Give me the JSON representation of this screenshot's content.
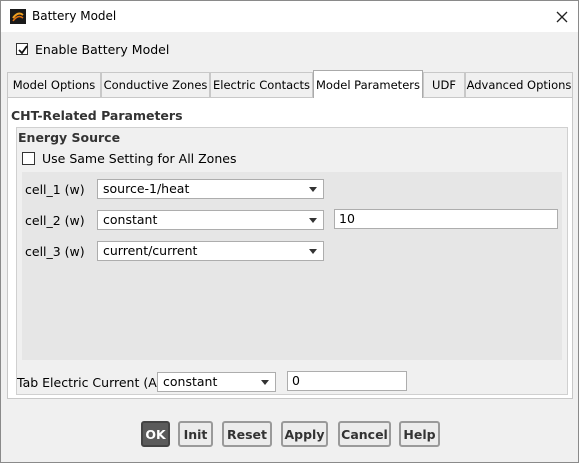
{
  "window": {
    "title": "Battery Model"
  },
  "enable": {
    "label": "Enable Battery Model",
    "checked": true
  },
  "tabs": [
    {
      "label": "Model Options",
      "active": false
    },
    {
      "label": "Conductive Zones",
      "active": false
    },
    {
      "label": "Electric Contacts",
      "active": false
    },
    {
      "label": "Model Parameters",
      "active": true
    },
    {
      "label": "UDF",
      "active": false
    },
    {
      "label": "Advanced Options",
      "active": false
    }
  ],
  "cht": {
    "title": "CHT-Related Parameters",
    "energy_source": {
      "title": "Energy Source",
      "same_setting_label": "Use Same Setting for All Zones",
      "same_setting_checked": false,
      "zones": [
        {
          "label": "cell_1 (w)",
          "selection": "source-1/heat",
          "value": ""
        },
        {
          "label": "cell_2 (w)",
          "selection": "constant",
          "value": "10"
        },
        {
          "label": "cell_3 (w)",
          "selection": "current/current",
          "value": ""
        }
      ]
    },
    "tab_current": {
      "label": "Tab Electric Current (A)",
      "selection": "constant",
      "value": "0"
    }
  },
  "buttons": {
    "ok": "OK",
    "init": "Init",
    "reset": "Reset",
    "apply": "Apply",
    "cancel": "Cancel",
    "help": "Help"
  },
  "colors": {
    "active_tab": "#ffffff",
    "ok_button": "#5b5b5b",
    "dialog_bg": "#f0f0f0"
  }
}
